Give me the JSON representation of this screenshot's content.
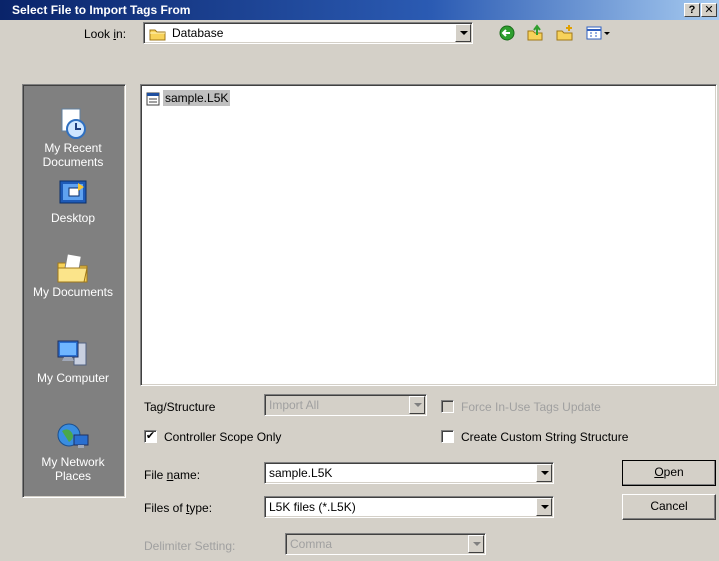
{
  "window": {
    "title": "Select File to Import Tags From",
    "help": "?",
    "close": "✕"
  },
  "lookin": {
    "label_pre": "Look ",
    "label_key": "i",
    "label_post": "n:",
    "value": "Database"
  },
  "places": [
    {
      "line1": "My Recent",
      "line2": "Documents"
    },
    {
      "line1": "Desktop",
      "line2": ""
    },
    {
      "line1": "My Documents",
      "line2": ""
    },
    {
      "line1": "My Computer",
      "line2": ""
    },
    {
      "line1": "My Network",
      "line2": "Places"
    }
  ],
  "files": [
    {
      "name": "sample.L5K"
    }
  ],
  "tagstructure": {
    "label": "Tag/Structure",
    "value": "Import All"
  },
  "force_inuse": {
    "label": "Force In-Use Tags Update"
  },
  "controller_scope": {
    "label": "Controller Scope Only",
    "checked": "✔"
  },
  "custom_string": {
    "label": "Create Custom String Structure"
  },
  "filename": {
    "label_pre": "File ",
    "label_key": "n",
    "label_post": "ame:",
    "value": "sample.L5K"
  },
  "filetype": {
    "label_pre": "Files of ",
    "label_key": "t",
    "label_post": "ype:",
    "value": "L5K files (*.L5K)"
  },
  "delimiter": {
    "label": "Delimiter Setting:",
    "value": "Comma"
  },
  "buttons": {
    "open_key": "O",
    "open_rest": "pen",
    "cancel": "Cancel"
  },
  "colors": {
    "title_bar": "#0a246a",
    "dialog_bg": "#d4d0c8",
    "places_bg": "#808080"
  }
}
